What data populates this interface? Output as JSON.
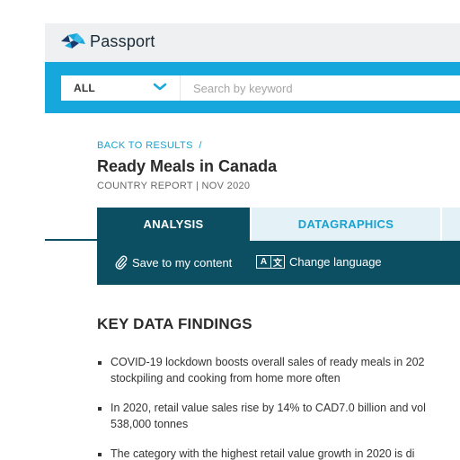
{
  "header": {
    "brand": "Passport",
    "logo_icon": "passport-logo-icon"
  },
  "search": {
    "category_value": "ALL",
    "placeholder": "Search by keyword",
    "value": ""
  },
  "breadcrumb": {
    "link": "BACK TO RESULTS",
    "separator": "/"
  },
  "report": {
    "title": "Ready Meals in Canada",
    "meta": "COUNTRY REPORT | NOV 2020"
  },
  "tabs": [
    {
      "label": "ANALYSIS",
      "active": true
    },
    {
      "label": "DATAGRAPHICS",
      "active": false
    }
  ],
  "actions": {
    "save_label": "Save to my content",
    "save_icon": "paperclip-icon",
    "language_label": "Change language",
    "language_icon_glyphs": [
      "A",
      "文"
    ]
  },
  "key_findings": {
    "title": "KEY DATA FINDINGS",
    "items": [
      "COVID-19 lockdown boosts overall sales of ready meals in 202 stockpiling and cooking from home more often",
      "In 2020, retail value sales rise by 14% to CAD7.0 billion and vol 538,000 tonnes",
      "The category with the highest retail value growth in 2020 is di"
    ]
  },
  "colors": {
    "brand_blue": "#16a8dc",
    "dark_teal": "#0c4f63",
    "link_blue": "#17a2cf"
  }
}
